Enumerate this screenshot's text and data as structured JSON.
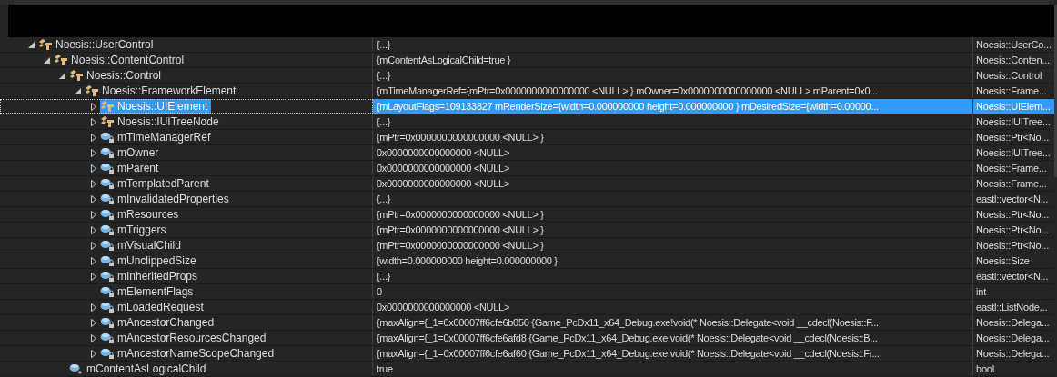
{
  "watch": {
    "rows": [
      {
        "kind": "base",
        "name": "Noesis::UserControl",
        "value": "{...}",
        "type": "Noesis::UserCo...",
        "expandable": true,
        "expanded": true,
        "selected": false,
        "children": [
          {
            "kind": "base",
            "name": "Noesis::ContentControl",
            "value": "{mContentAsLogicalChild=true }",
            "type": "Noesis::Conten...",
            "expandable": true,
            "expanded": true,
            "selected": false,
            "children": [
              {
                "kind": "base",
                "name": "Noesis::Control",
                "value": "{...}",
                "type": "Noesis::Control",
                "expandable": true,
                "expanded": true,
                "selected": false,
                "children": [
                  {
                    "kind": "base",
                    "name": "Noesis::FrameworkElement",
                    "value": "{mTimeManagerRef={mPtr=0x0000000000000000 <NULL> } mOwner=0x0000000000000000 <NULL> mParent=0x0...",
                    "type": "Noesis::Frame...",
                    "expandable": true,
                    "expanded": true,
                    "selected": false,
                    "children": [
                      {
                        "kind": "base",
                        "name": "Noesis::UIElement",
                        "value": "{mLayoutFlags=109133827 mRenderSize={width=0.000000000 height=0.000000000 } mDesiredSize={width=0.00000...",
                        "type": "Noesis::UIElem...",
                        "expandable": true,
                        "expanded": false,
                        "selected": true
                      },
                      {
                        "kind": "base",
                        "name": "Noesis::IUITreeNode",
                        "value": "{...}",
                        "type": "Noesis::IUITree...",
                        "expandable": true,
                        "expanded": false,
                        "selected": false
                      },
                      {
                        "kind": "private",
                        "name": "mTimeManagerRef",
                        "value": "{mPtr=0x0000000000000000 <NULL> }",
                        "type": "Noesis::Ptr<No...",
                        "expandable": true,
                        "expanded": false,
                        "selected": false
                      },
                      {
                        "kind": "private",
                        "name": "mOwner",
                        "value": "0x0000000000000000 <NULL>",
                        "type": "Noesis::IUITree...",
                        "expandable": true,
                        "expanded": false,
                        "selected": false
                      },
                      {
                        "kind": "private",
                        "name": "mParent",
                        "value": "0x0000000000000000 <NULL>",
                        "type": "Noesis::Frame...",
                        "expandable": true,
                        "expanded": false,
                        "selected": false
                      },
                      {
                        "kind": "private",
                        "name": "mTemplatedParent",
                        "value": "0x0000000000000000 <NULL>",
                        "type": "Noesis::Frame...",
                        "expandable": true,
                        "expanded": false,
                        "selected": false
                      },
                      {
                        "kind": "private",
                        "name": "mInvalidatedProperties",
                        "value": "{...}",
                        "type": "eastl::vector<N...",
                        "expandable": true,
                        "expanded": false,
                        "selected": false
                      },
                      {
                        "kind": "private",
                        "name": "mResources",
                        "value": "{mPtr=0x0000000000000000 <NULL> }",
                        "type": "Noesis::Ptr<No...",
                        "expandable": true,
                        "expanded": false,
                        "selected": false
                      },
                      {
                        "kind": "private",
                        "name": "mTriggers",
                        "value": "{mPtr=0x0000000000000000 <NULL> }",
                        "type": "Noesis::Ptr<No...",
                        "expandable": true,
                        "expanded": false,
                        "selected": false
                      },
                      {
                        "kind": "private",
                        "name": "mVisualChild",
                        "value": "{mPtr=0x0000000000000000 <NULL> }",
                        "type": "Noesis::Ptr<No...",
                        "expandable": true,
                        "expanded": false,
                        "selected": false
                      },
                      {
                        "kind": "private",
                        "name": "mUnclippedSize",
                        "value": "{width=0.000000000 height=0.000000000 }",
                        "type": "Noesis::Size",
                        "expandable": true,
                        "expanded": false,
                        "selected": false
                      },
                      {
                        "kind": "private",
                        "name": "mInheritedProps",
                        "value": "{...}",
                        "type": "eastl::vector<N...",
                        "expandable": true,
                        "expanded": false,
                        "selected": false
                      },
                      {
                        "kind": "private",
                        "name": "mElementFlags",
                        "value": "0",
                        "type": "int",
                        "expandable": false,
                        "selected": false
                      },
                      {
                        "kind": "private",
                        "name": "mLoadedRequest",
                        "value": "0x0000000000000000 <NULL>",
                        "type": "eastl::ListNode...",
                        "expandable": true,
                        "expanded": false,
                        "selected": false
                      },
                      {
                        "kind": "private",
                        "name": "mAncestorChanged",
                        "value": "{maxAlign={_1=0x00007ff6cfe6b050 {Game_PcDx11_x64_Debug.exe!void(* Noesis::Delegate<void __cdecl(Noesis::F...",
                        "type": "Noesis::Delega...",
                        "expandable": true,
                        "expanded": false,
                        "selected": false
                      },
                      {
                        "kind": "private",
                        "name": "mAncestorResourcesChanged",
                        "value": "{maxAlign={_1=0x00007ff6cfe6afd8 {Game_PcDx11_x64_Debug.exe!void(* Noesis::Delegate<void __cdecl(Noesis::B...",
                        "type": "Noesis::Delega...",
                        "expandable": true,
                        "expanded": false,
                        "selected": false
                      },
                      {
                        "kind": "private",
                        "name": "mAncestorNameScopeChanged",
                        "value": "{maxAlign={_1=0x00007ff6cfe6af60 {Game_PcDx11_x64_Debug.exe!void(* Noesis::Delegate<void __cdecl(Noesis::Fr...",
                        "type": "Noesis::Delega...",
                        "expandable": true,
                        "expanded": false,
                        "selected": false
                      }
                    ]
                  }
                ]
              },
              {
                "kind": "protected",
                "name": "mContentAsLogicalChild",
                "value": "true",
                "type": "bool",
                "expandable": false,
                "selected": false
              }
            ]
          }
        ]
      }
    ]
  }
}
